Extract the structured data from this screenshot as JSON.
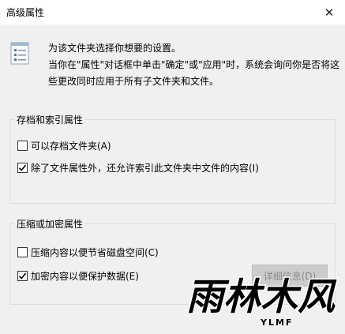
{
  "window": {
    "title": "高级属性",
    "close_glyph": "✕"
  },
  "description": {
    "line1": "为该文件夹选择你想要的设置。",
    "line2": "当你在\"属性\"对话框中单击\"确定\"或\"应用\"时，系统会询问你是否将这些更改同时应用于所有子文件夹和文件。"
  },
  "archive_group": {
    "label": "存档和索引属性",
    "options": [
      {
        "label": "可以存档文件夹(A)",
        "checked": false
      },
      {
        "label": "除了文件属性外，还允许索引此文件夹中文件的内容(I)",
        "checked": true
      }
    ]
  },
  "compress_group": {
    "label": "压缩或加密属性",
    "options": [
      {
        "label": "压缩内容以便节省磁盘空间(C)",
        "checked": false
      },
      {
        "label": "加密内容以便保护数据(E)",
        "checked": true
      }
    ],
    "details_button": "详细信息(D)"
  },
  "watermark": {
    "logo_text": "雨林木风",
    "sub_text": "YLMF"
  }
}
